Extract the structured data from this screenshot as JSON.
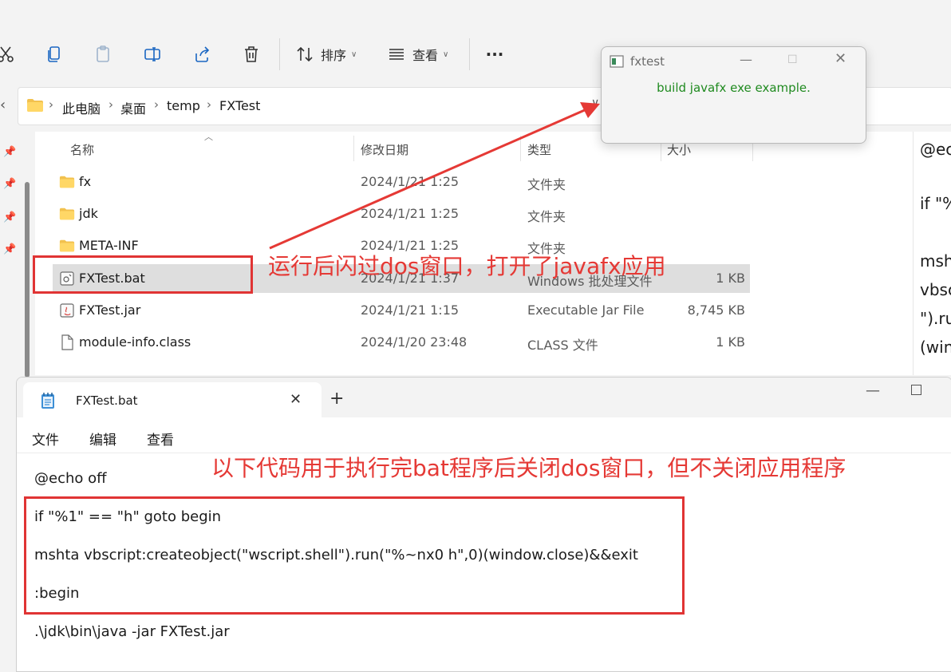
{
  "toolbar": {
    "sort_label": "排序",
    "view_label": "查看",
    "more_label": "···"
  },
  "address": {
    "crumbs": [
      "此电脑",
      "桌面",
      "temp",
      "FXTest"
    ]
  },
  "columns": {
    "name": "名称",
    "date": "修改日期",
    "type": "类型",
    "size": "大小"
  },
  "files": [
    {
      "name": "fx",
      "date": "2024/1/21 1:25",
      "type": "文件夹",
      "size": "",
      "icon": "folder-icon"
    },
    {
      "name": "jdk",
      "date": "2024/1/21 1:25",
      "type": "文件夹",
      "size": "",
      "icon": "folder-icon"
    },
    {
      "name": "META-INF",
      "date": "2024/1/21 1:25",
      "type": "文件夹",
      "size": "",
      "icon": "folder-icon"
    },
    {
      "name": "FXTest.bat",
      "date": "2024/1/21 1:37",
      "type": "Windows 批处理文件",
      "size": "1 KB",
      "icon": "batch-file-icon"
    },
    {
      "name": "FXTest.jar",
      "date": "2024/1/21 1:15",
      "type": "Executable Jar File",
      "size": "8,745 KB",
      "icon": "jar-file-icon"
    },
    {
      "name": "module-info.class",
      "date": "2024/1/20 23:48",
      "type": "CLASS 文件",
      "size": "1 KB",
      "icon": "file-icon"
    }
  ],
  "detail_pane": [
    "@ec",
    "if \"%",
    "msh",
    "vbsc",
    "\").ru",
    "(win"
  ],
  "fxwindow": {
    "title": "fxtest",
    "message": "build javafx exe example."
  },
  "notepad": {
    "tab_title": "FXTest.bat",
    "menu": [
      "文件",
      "编辑",
      "查看"
    ],
    "lines": [
      "@echo off",
      "if \"%1\" == \"h\" goto begin",
      "mshta vbscript:createobject(\"wscript.shell\").run(\"%~nx0 h\",0)(window.close)&&exit",
      ":begin",
      ".\\jdk\\bin\\java -jar FXTest.jar"
    ]
  },
  "annotations": {
    "top": "运行后闪过dos窗口，打开了javafx应用",
    "bottom": "以下代码用于执行完bat程序后关闭dos窗口，但不关闭应用程序"
  },
  "colors": {
    "annotation_red": "#e53935",
    "fx_message_green": "#1f8a1f",
    "selection": "#dedede"
  }
}
